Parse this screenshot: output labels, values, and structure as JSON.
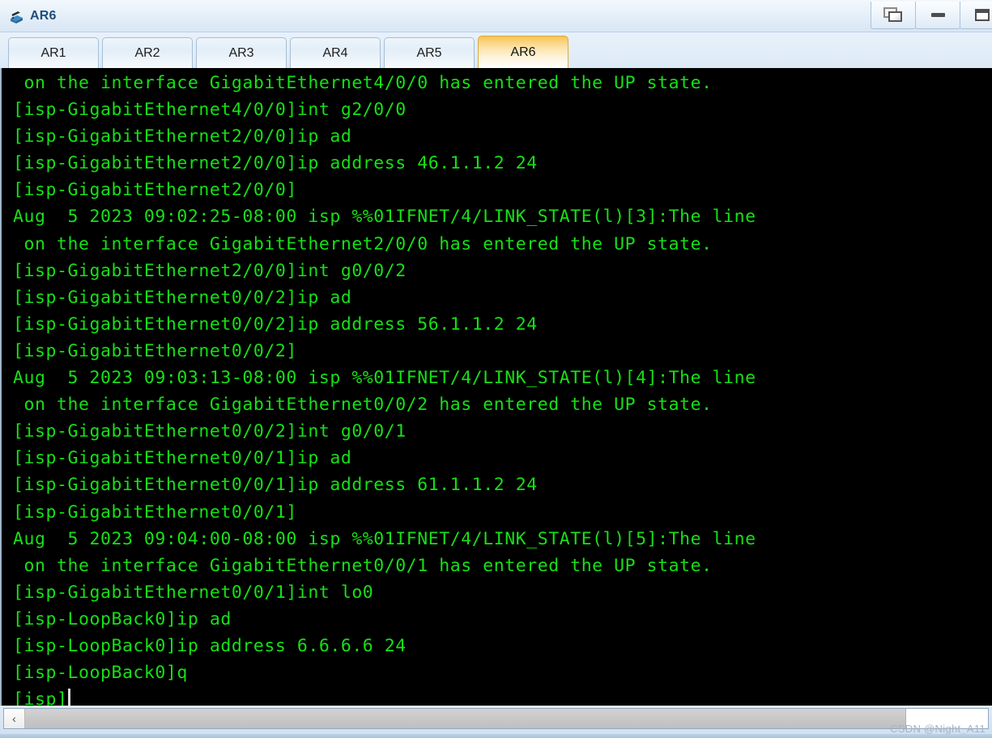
{
  "window": {
    "title": "AR6",
    "icon": "router-icon",
    "controls": [
      {
        "name": "restore-button",
        "icon": "restore-icon",
        "label": "Restore"
      },
      {
        "name": "minimize-button",
        "icon": "minimize-icon",
        "label": "Minimize"
      },
      {
        "name": "maximize-button",
        "icon": "maximize-icon",
        "label": "Maximize"
      }
    ]
  },
  "tabs": {
    "items": [
      {
        "label": "AR1",
        "active": false
      },
      {
        "label": "AR2",
        "active": false
      },
      {
        "label": "AR3",
        "active": false
      },
      {
        "label": "AR4",
        "active": false
      },
      {
        "label": "AR5",
        "active": false
      },
      {
        "label": "AR6",
        "active": true
      }
    ],
    "active_label": "AR6"
  },
  "terminal": {
    "foreground_color": "#16e016",
    "background_color": "#000000",
    "lines": [
      " on the interface GigabitEthernet4/0/0 has entered the UP state.",
      "[isp-GigabitEthernet4/0/0]int g2/0/0",
      "[isp-GigabitEthernet2/0/0]ip ad",
      "[isp-GigabitEthernet2/0/0]ip address 46.1.1.2 24",
      "[isp-GigabitEthernet2/0/0]",
      "Aug  5 2023 09:02:25-08:00 isp %%01IFNET/4/LINK_STATE(l)[3]:The line",
      " on the interface GigabitEthernet2/0/0 has entered the UP state.",
      "[isp-GigabitEthernet2/0/0]int g0/0/2",
      "[isp-GigabitEthernet0/0/2]ip ad",
      "[isp-GigabitEthernet0/0/2]ip address 56.1.1.2 24",
      "[isp-GigabitEthernet0/0/2]",
      "Aug  5 2023 09:03:13-08:00 isp %%01IFNET/4/LINK_STATE(l)[4]:The line",
      " on the interface GigabitEthernet0/0/2 has entered the UP state.",
      "[isp-GigabitEthernet0/0/2]int g0/0/1",
      "[isp-GigabitEthernet0/0/1]ip ad",
      "[isp-GigabitEthernet0/0/1]ip address 61.1.1.2 24",
      "[isp-GigabitEthernet0/0/1]",
      "Aug  5 2023 09:04:00-08:00 isp %%01IFNET/4/LINK_STATE(l)[5]:The line",
      " on the interface GigabitEthernet0/0/1 has entered the UP state.",
      "[isp-GigabitEthernet0/0/1]int lo0",
      "[isp-LoopBack0]ip ad",
      "[isp-LoopBack0]ip address 6.6.6.6 24",
      "[isp-LoopBack0]q"
    ],
    "prompt": "[isp]"
  },
  "scrollbar": {
    "left_arrow": "‹",
    "orientation": "horizontal"
  },
  "watermark": {
    "text": "CSDN @Night_A11"
  }
}
